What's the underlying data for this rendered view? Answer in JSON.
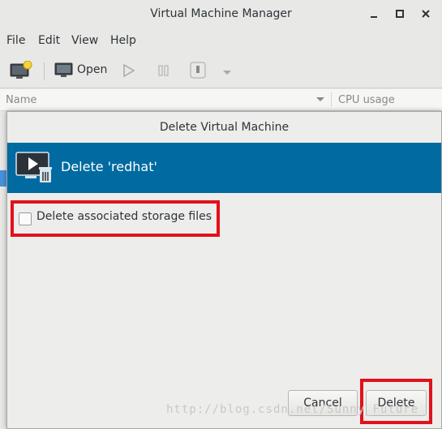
{
  "window": {
    "title": "Virtual Machine Manager",
    "controls": [
      "minimize",
      "maximize",
      "close"
    ]
  },
  "menubar": {
    "items": [
      "File",
      "Edit",
      "View",
      "Help"
    ]
  },
  "toolbar": {
    "new_icon": "new-vm-icon",
    "open_label": "Open",
    "run_icon": "play-icon",
    "pause_icon": "pause-icon",
    "shutdown_icon": "shutdown-icon",
    "dropdown_icon": "chevron-down-icon"
  },
  "columns": {
    "name": "Name",
    "cpu": "CPU usage"
  },
  "dialog": {
    "title": "Delete Virtual Machine",
    "header_text": "Delete 'redhat'",
    "checkbox_label": "Delete associated storage files",
    "checkbox_checked": false,
    "cancel_label": "Cancel",
    "delete_label": "Delete"
  },
  "colors": {
    "banner": "#006aa1",
    "highlight": "#e2111b"
  },
  "watermark": "http://blog.csdn.net/Sunny_Future"
}
